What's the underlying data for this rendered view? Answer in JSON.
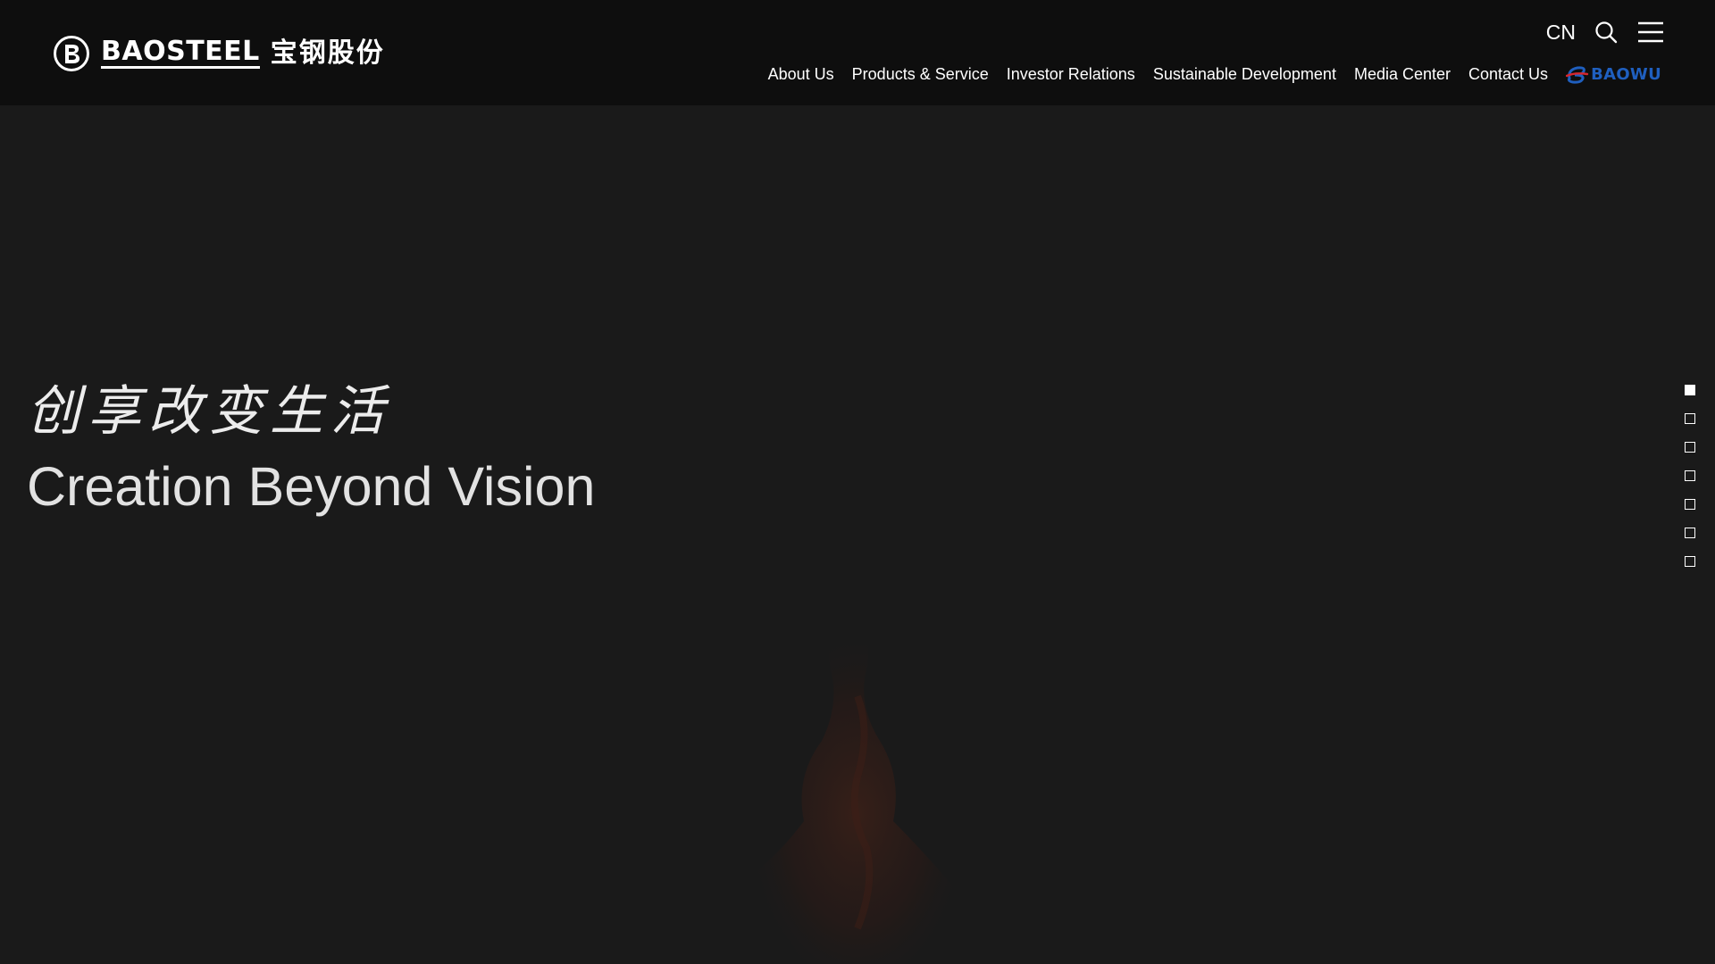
{
  "header": {
    "logo": {
      "text_en": "BAOSTEEL",
      "text_cn": "宝钢股份"
    },
    "language_label": "CN",
    "icons": {
      "search": "search-icon",
      "menu": "hamburger-menu-icon"
    },
    "nav": [
      {
        "label": "About Us"
      },
      {
        "label": "Products & Service"
      },
      {
        "label": "Investor Relations"
      },
      {
        "label": "Sustainable Development"
      },
      {
        "label": "Media Center"
      },
      {
        "label": "Contact Us"
      }
    ],
    "partner_logo": {
      "text": "BAOWU",
      "color": "#1f5fbf",
      "accent": "#d7262e"
    }
  },
  "hero": {
    "slogan_cn": "创享改变生活",
    "slogan_en": "Creation Beyond Vision",
    "pager": {
      "total": 7,
      "active_index": 0
    }
  },
  "colors": {
    "header_bg": "#0e0e0e",
    "page_bg": "#1a1a1a",
    "text": "#ffffff"
  }
}
